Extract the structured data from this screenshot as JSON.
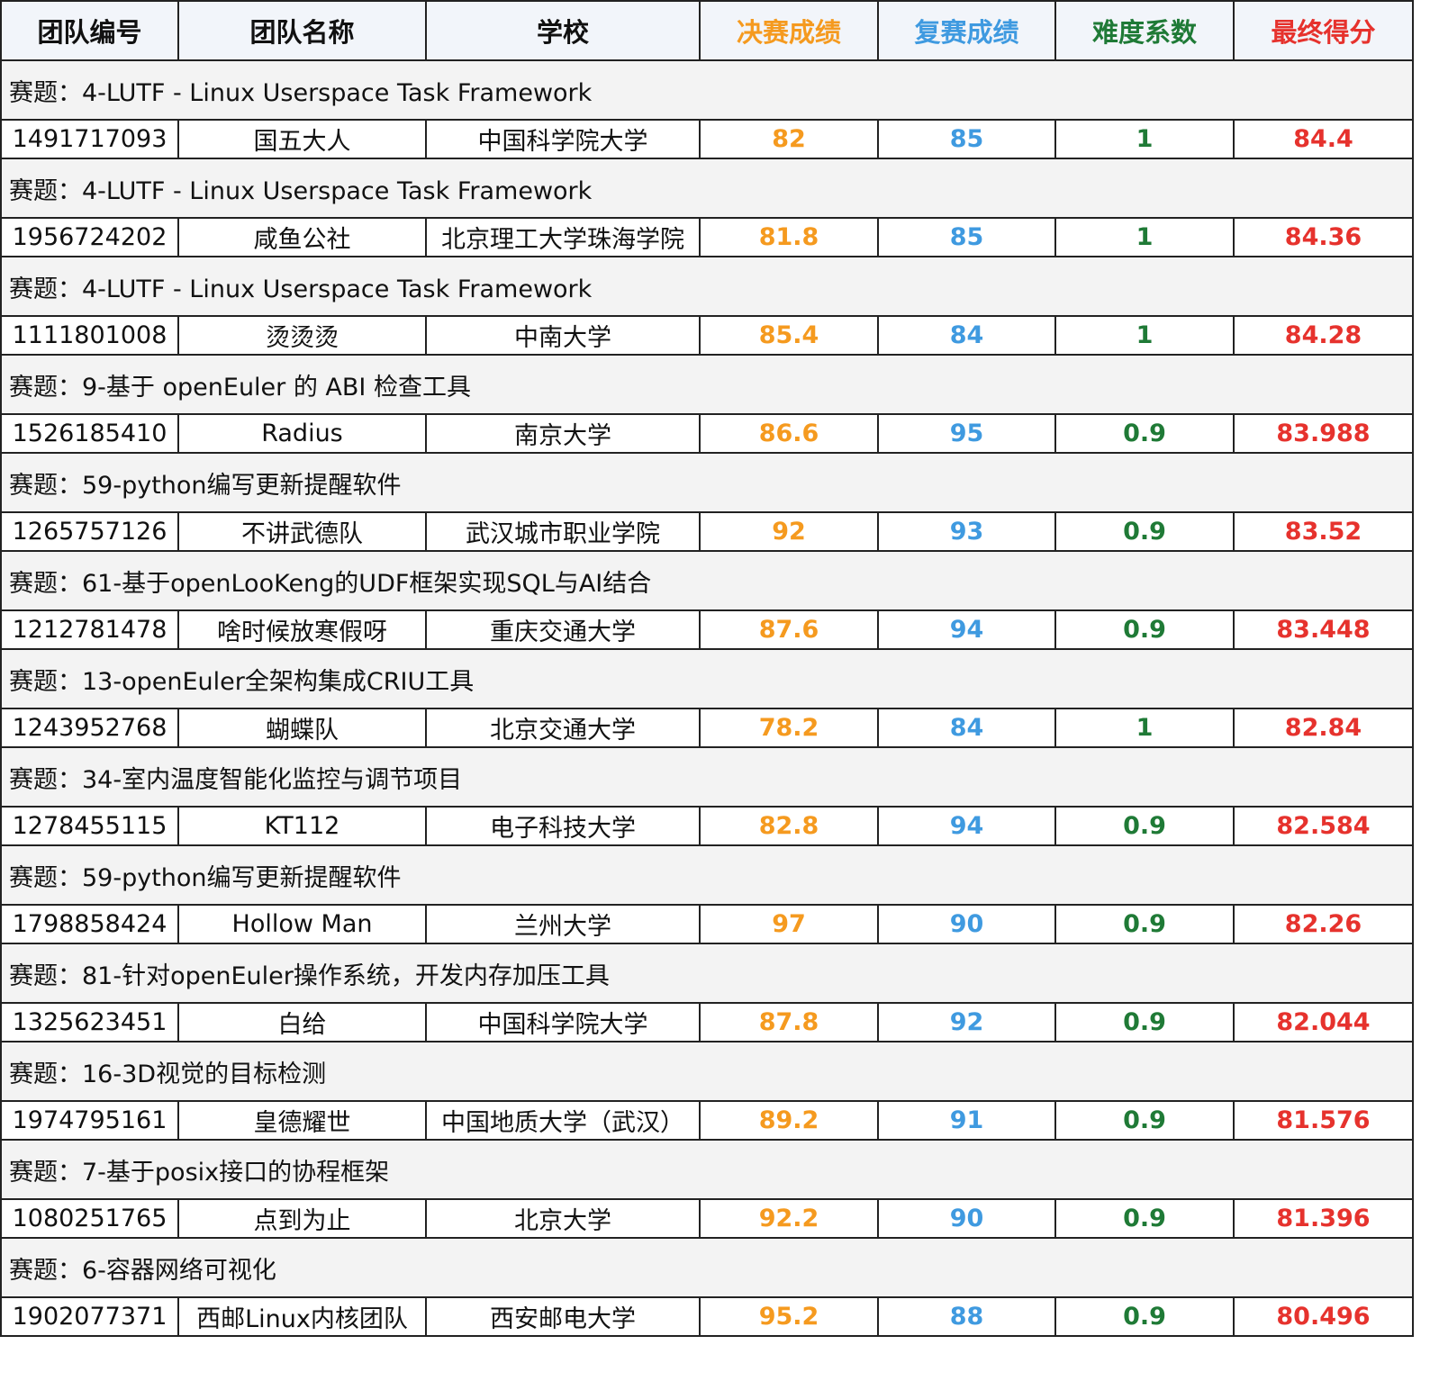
{
  "table": {
    "headers": {
      "team_id": "团队编号",
      "team_name": "团队名称",
      "school": "学校",
      "final_score": "决赛成绩",
      "semi_score": "复赛成绩",
      "difficulty": "难度系数",
      "total_score": "最终得分"
    },
    "colors": {
      "final_score": "#f59a1f",
      "semi_score": "#3f9ae0",
      "difficulty": "#1f7a36",
      "total_score": "#e6322d"
    },
    "entries": [
      {
        "topic": "赛题：4-LUTF - Linux Userspace Task Framework",
        "team_id": "1491717093",
        "team_name": "国五大人",
        "school": "中国科学院大学",
        "final_score": "82",
        "semi_score": "85",
        "difficulty": "1",
        "total_score": "84.4"
      },
      {
        "topic": "赛题：4-LUTF - Linux Userspace Task Framework",
        "team_id": "1956724202",
        "team_name": "咸鱼公社",
        "school": "北京理工大学珠海学院",
        "final_score": "81.8",
        "semi_score": "85",
        "difficulty": "1",
        "total_score": "84.36"
      },
      {
        "topic": "赛题：4-LUTF - Linux Userspace Task Framework",
        "team_id": "1111801008",
        "team_name": "烫烫烫",
        "school": "中南大学",
        "final_score": "85.4",
        "semi_score": "84",
        "difficulty": "1",
        "total_score": "84.28"
      },
      {
        "topic": "赛题：9-基于 openEuler 的 ABI 检查工具",
        "team_id": "1526185410",
        "team_name": "Radius",
        "school": "南京大学",
        "final_score": "86.6",
        "semi_score": "95",
        "difficulty": "0.9",
        "total_score": "83.988"
      },
      {
        "topic": "赛题：59-python编写更新提醒软件",
        "team_id": "1265757126",
        "team_name": "不讲武德队",
        "school": "武汉城市职业学院",
        "final_score": "92",
        "semi_score": "93",
        "difficulty": "0.9",
        "total_score": "83.52"
      },
      {
        "topic": "赛题：61-基于openLooKeng的UDF框架实现SQL与AI结合",
        "team_id": "1212781478",
        "team_name": "啥时候放寒假呀",
        "school": "重庆交通大学",
        "final_score": "87.6",
        "semi_score": "94",
        "difficulty": "0.9",
        "total_score": "83.448"
      },
      {
        "topic": "赛题：13-openEuler全架构集成CRIU工具",
        "team_id": "1243952768",
        "team_name": "蝴蝶队",
        "school": "北京交通大学",
        "final_score": "78.2",
        "semi_score": "84",
        "difficulty": "1",
        "total_score": "82.84"
      },
      {
        "topic": "赛题：34-室内温度智能化监控与调节项目",
        "team_id": "1278455115",
        "team_name": "KT112",
        "school": "电子科技大学",
        "final_score": "82.8",
        "semi_score": "94",
        "difficulty": "0.9",
        "total_score": "82.584"
      },
      {
        "topic": "赛题：59-python编写更新提醒软件",
        "team_id": "1798858424",
        "team_name": "Hollow Man",
        "school": "兰州大学",
        "final_score": "97",
        "semi_score": "90",
        "difficulty": "0.9",
        "total_score": "82.26"
      },
      {
        "topic": "赛题：81-针对openEuler操作系统，开发内存加压工具",
        "team_id": "1325623451",
        "team_name": "白给",
        "school": "中国科学院大学",
        "final_score": "87.8",
        "semi_score": "92",
        "difficulty": "0.9",
        "total_score": "82.044"
      },
      {
        "topic": "赛题：16-3D视觉的目标检测",
        "team_id": "1974795161",
        "team_name": "皇德耀世",
        "school": "中国地质大学（武汉）",
        "final_score": "89.2",
        "semi_score": "91",
        "difficulty": "0.9",
        "total_score": "81.576"
      },
      {
        "topic": "赛题：7-基于posix接口的协程框架",
        "team_id": "1080251765",
        "team_name": "点到为止",
        "school": "北京大学",
        "final_score": "92.2",
        "semi_score": "90",
        "difficulty": "0.9",
        "total_score": "81.396"
      },
      {
        "topic": "赛题：6-容器网络可视化",
        "team_id": "1902077371",
        "team_name": "西邮Linux内核团队",
        "school": "西安邮电大学",
        "final_score": "95.2",
        "semi_score": "88",
        "difficulty": "0.9",
        "total_score": "80.496"
      }
    ]
  }
}
